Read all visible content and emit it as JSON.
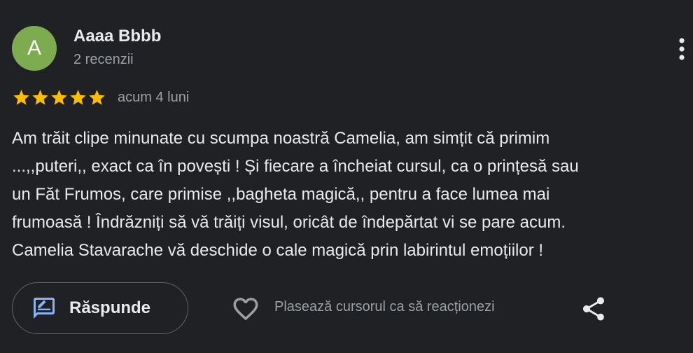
{
  "colors": {
    "background": "#202124",
    "avatar_bg": "#7cac4f",
    "star": "#fbbc04",
    "text_primary": "#e8eaed",
    "text_secondary": "#9aa0a6",
    "icon_blue": "#8ab4f8",
    "border": "#5f6368"
  },
  "review": {
    "author": {
      "initial": "A",
      "name": "Aaaa Bbbb",
      "meta": "2 recenzii"
    },
    "rating": 5,
    "rating_max": 5,
    "date": "acum 4 luni",
    "text_lines": [
      "Am trăit clipe minunate cu scumpa noastră Camelia, am simțit că primim",
      "...,,puteri,, exact ca în povești ! Și fiecare a încheiat cursul, ca o prințesă sau",
      "un Făt Frumos, care primise ,,bagheta magică,, pentru a face lumea mai",
      "frumoasă ! Îndrăzniți să vă trăiți visul, oricât de îndepărtat vi se pare acum.",
      "Camelia Stavarache vă deschide o cale magică prin labirintul emoțiilor !"
    ]
  },
  "actions": {
    "reply_label": "Răspunde",
    "react_hint": "Plasează cursorul ca să reacționezi",
    "icons": {
      "reply": "rate-review-icon",
      "like": "heart-outline-icon",
      "share": "share-icon",
      "more": "more-vert-icon"
    }
  }
}
